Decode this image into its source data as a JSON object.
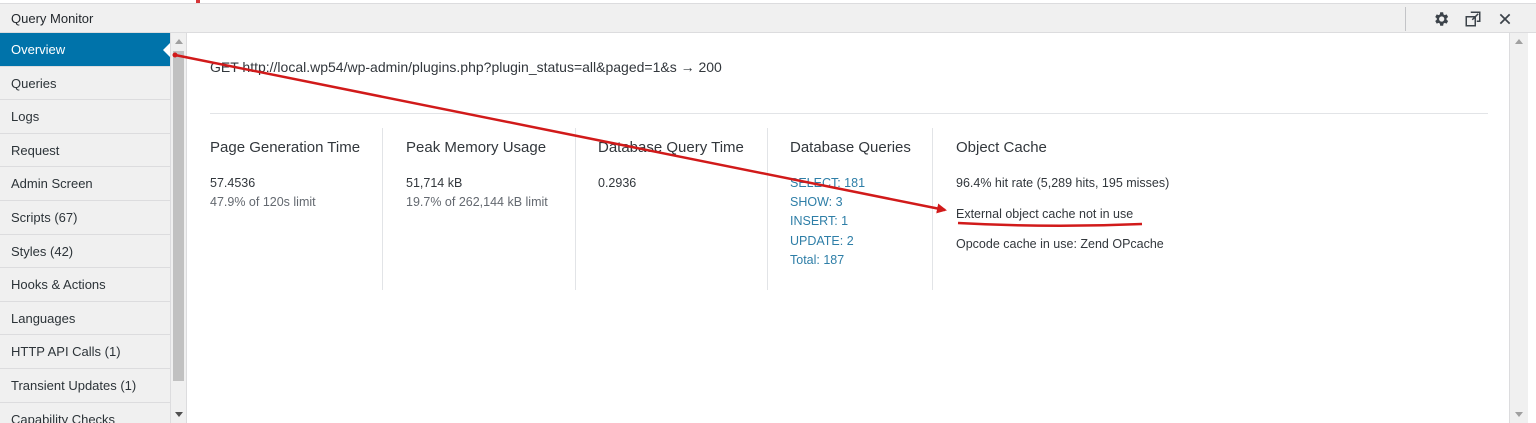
{
  "window": {
    "title": "Query Monitor",
    "buttons": [
      {
        "name": "settings-button",
        "icon": "gear-icon"
      },
      {
        "name": "popout-button",
        "icon": "popout-icon"
      },
      {
        "name": "close-button",
        "icon": "close-icon"
      }
    ]
  },
  "sidebar": {
    "items": [
      {
        "label": "Overview",
        "active": true
      },
      {
        "label": "Queries"
      },
      {
        "label": "Logs"
      },
      {
        "label": "Request"
      },
      {
        "label": "Admin Screen"
      },
      {
        "label": "Scripts (67)"
      },
      {
        "label": "Styles (42)"
      },
      {
        "label": "Hooks & Actions"
      },
      {
        "label": "Languages"
      },
      {
        "label": "HTTP API Calls (1)"
      },
      {
        "label": "Transient Updates (1)"
      },
      {
        "label": "Capability Checks"
      }
    ]
  },
  "overview": {
    "request": "GET http://local.wp54/wp-admin/plugins.php?plugin_status=all&paged=1&s → 200",
    "page_generation": {
      "heading": "Page Generation Time",
      "value": "57.4536",
      "sub": "47.9% of 120s limit"
    },
    "peak_memory": {
      "heading": "Peak Memory Usage",
      "value": "51,714 kB",
      "sub": "19.7% of 262,144 kB limit"
    },
    "db_query_time": {
      "heading": "Database Query Time",
      "value": "0.2936"
    },
    "db_queries": {
      "heading": "Database Queries",
      "lines": [
        "SELECT: 181",
        "SHOW: 3",
        "INSERT: 1",
        "UPDATE: 2",
        "Total: 187"
      ]
    },
    "object_cache": {
      "heading": "Object Cache",
      "hit_rate": "96.4% hit rate (5,289 hits, 195 misses)",
      "external": "External object cache not in use",
      "opcode": "Opcode cache in use: Zend OPcache"
    }
  },
  "colors": {
    "active_item": "#0073aa",
    "link": "#2e7ea7",
    "annotation": "#d11a1a"
  }
}
